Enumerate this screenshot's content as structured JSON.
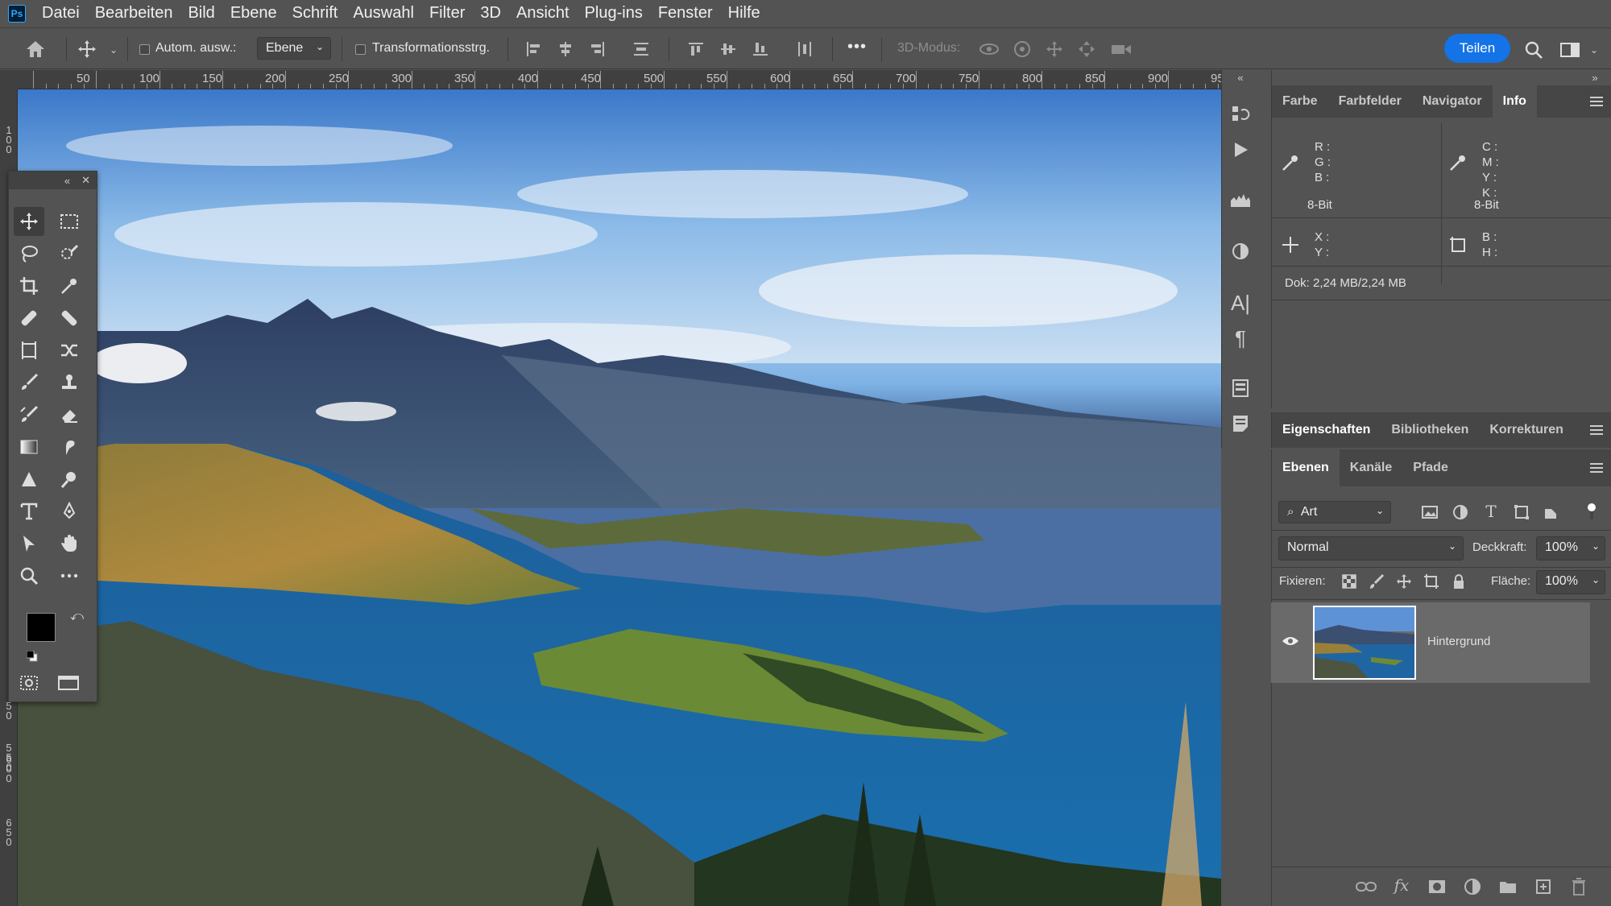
{
  "app": {
    "logo": "Ps",
    "accent": "#31a8ff"
  },
  "menu": [
    "Datei",
    "Bearbeiten",
    "Bild",
    "Ebene",
    "Schrift",
    "Auswahl",
    "Filter",
    "3D",
    "Ansicht",
    "Plug-ins",
    "Fenster",
    "Hilfe"
  ],
  "options": {
    "auto_select_label": "Autom. ausw.:",
    "auto_select_target": "Ebene",
    "transform_label": "Transformationsstrg.",
    "more": "•••",
    "mode3d_label": "3D-Modus:",
    "share_label": "Teilen"
  },
  "ruler_h": [
    "50",
    "100",
    "150",
    "200",
    "250",
    "300",
    "350",
    "400",
    "450",
    "500",
    "550",
    "600",
    "650",
    "700",
    "750",
    "800",
    "850",
    "900",
    "95"
  ],
  "ruler_v": [
    "1\n0\n0",
    "5\n0",
    "5\n5\n0",
    "6\n0\n0",
    "6\n5\n0"
  ],
  "info_panel": {
    "tabs": [
      "Farbe",
      "Farbfelder",
      "Navigator",
      "Info"
    ],
    "selected_tab": "Info",
    "rgb_labels": "R :\nG :\nB :",
    "cmyk_labels": "C :\nM :\nY :\nK :",
    "bit_left": "8-Bit",
    "bit_right": "8-Bit",
    "xy_labels": "X :\nY :",
    "bh_labels": "B :\nH :",
    "doc": "Dok: 2,24 MB/2,24 MB"
  },
  "props_panel": {
    "tabs": [
      "Eigenschaften",
      "Bibliotheken",
      "Korrekturen"
    ]
  },
  "layers_panel": {
    "tabs": [
      "Ebenen",
      "Kanäle",
      "Pfade"
    ],
    "filter": "Art",
    "blend_mode": "Normal",
    "opacity_label": "Deckkraft:",
    "opacity": "100%",
    "lock_label": "Fixieren:",
    "fill_label": "Fläche:",
    "fill": "100%",
    "layer_name": "Hintergrund"
  },
  "colors": {
    "foreground": "#000000",
    "background": "#ffffff",
    "share": "#1473e6"
  }
}
